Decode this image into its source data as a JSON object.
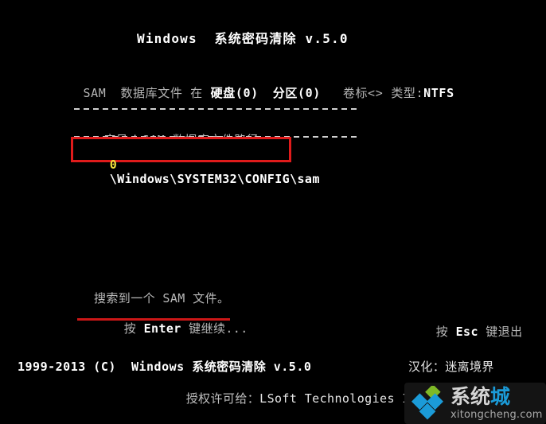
{
  "screen": {
    "background_color": "#000000",
    "foreground_color": "#c8c8c8"
  },
  "title": {
    "text": "Windows  系统密码清除 v.5.0"
  },
  "info_line": {
    "label_sam": "SAM",
    "label_database_file": "数据库文件 在",
    "disk": "硬盘(0)",
    "partition": "分区(0)",
    "volume_label": "卷标<>",
    "type_label": "类型:",
    "type_value": "NTFS"
  },
  "table": {
    "header_index": "序号",
    "header_separator": "|",
    "header_path": "SAM 数据库文件路径",
    "rows": [
      {
        "index": "0",
        "path": "\\Windows\\SYSTEM32\\CONFIG\\sam",
        "highlighted": true,
        "highlight_color": "#e01b1b",
        "index_color": "#f2e33c"
      }
    ]
  },
  "status": {
    "line1": "搜索到一个 SAM 文件。",
    "line2_prefix": "按 ",
    "line2_key": "Enter",
    "line2_suffix": " 键继续...",
    "underline_color": "#cc1717"
  },
  "esc_hint": {
    "prefix": "按 ",
    "key": "Esc",
    "suffix": " 键退出"
  },
  "footer": {
    "copyright": "1999-2013 (C)  Windows 系统密码清除 v.5.0",
    "license_label": "授权许可给：",
    "license_vendor": "LSoft Technologies Inc",
    "translation_credit": "汉化：迷离境界"
  },
  "watermark": {
    "brand_cn_main": "系统",
    "brand_cn_accent": "城",
    "domain": "xitongcheng.com",
    "logo_green": "#7fb927",
    "logo_blue": "#1b9bd8",
    "accent_color": "#1b9bd8"
  }
}
